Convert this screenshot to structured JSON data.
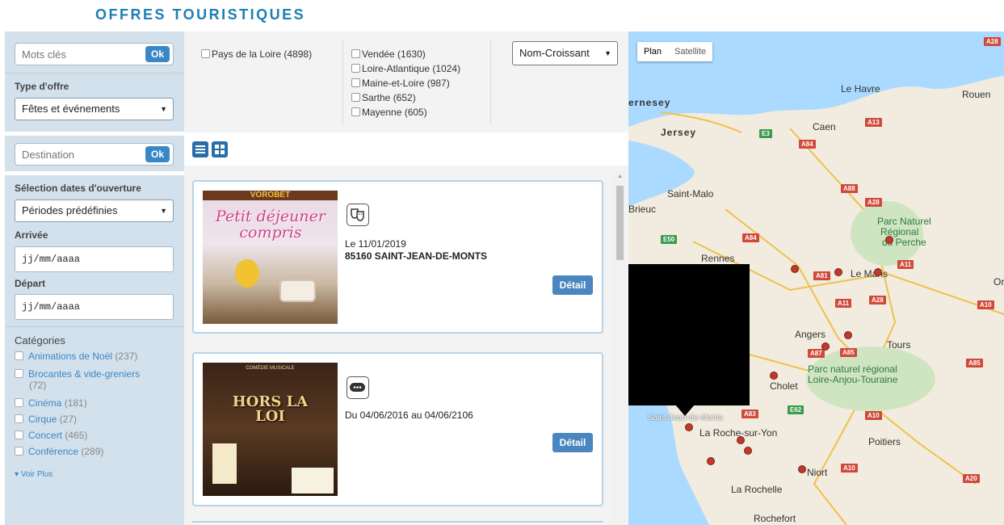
{
  "page_title": "OFFRES TOURISTIQUES",
  "sidebar": {
    "keywords_placeholder": "Mots clés",
    "ok_label": "Ok",
    "offer_type_label": "Type d'offre",
    "offer_type_value": "Fêtes et événements",
    "destination_placeholder": "Destination",
    "dates_label": "Sélection dates d'ouverture",
    "dates_value": "Périodes prédéfinies",
    "arrival_label": "Arrivée",
    "arrival_value": "jj/mm/aaaa",
    "departure_label": "Départ",
    "departure_value": "jj/mm/aaaa",
    "categories_label": "Catégories",
    "categories": [
      {
        "name": "Animations de Noël",
        "count": "(237)"
      },
      {
        "name": "Brocantes & vide-greniers",
        "count": "(72)"
      },
      {
        "name": "Cinéma",
        "count": "(181)"
      },
      {
        "name": "Cirque",
        "count": "(27)"
      },
      {
        "name": "Concert",
        "count": "(465)"
      },
      {
        "name": "Conférence",
        "count": "(289)"
      }
    ],
    "see_more": "Voir Plus"
  },
  "filters": {
    "region": "Pays de la Loire (4898)",
    "departments": [
      "Vendée (1630)",
      "Loire-Atlantique (1024)",
      "Maine-et-Loire (987)",
      "Sarthe (652)",
      "Mayenne (605)"
    ],
    "sort_value": "Nom-Croissant"
  },
  "results": [
    {
      "poster_title": "Petit déjeuner compris",
      "poster_top": "VOROBET",
      "date": "Le 11/01/2019",
      "city": "85160 SAINT-JEAN-DE-MONTS",
      "detail_label": "Détail",
      "icon": "theater-masks-icon"
    },
    {
      "poster_title": "HORS LA LOI",
      "poster_top": "COMÉDIE MUSICALE",
      "date": "Du 04/06/2016 au 04/06/2106",
      "city": "",
      "detail_label": "Détail",
      "icon": "ticket-icon"
    }
  ],
  "map": {
    "type_plan": "Plan",
    "type_satellite": "Satellite",
    "places": [
      "Le Havre",
      "Rouen",
      "ernesey",
      "Jersey",
      "Caen",
      "Saint-Malo",
      "Brieuc",
      "Rennes",
      "Le Mans",
      "Or",
      "Parc Naturel",
      "Régional",
      "du Perche",
      "Angers",
      "Tours",
      "Cholet",
      "Parc naturel régional",
      "Loire-Anjou-Touraine",
      "Saint-Jean-de-Monts",
      "La Roche-sur-Yon",
      "Poitiers",
      "Niort",
      "La Rochelle",
      "Rochefort"
    ],
    "roads": [
      "A28",
      "A13",
      "A84",
      "E3",
      "A88",
      "A28",
      "E50",
      "A84",
      "A11",
      "A81",
      "A11",
      "A28",
      "A10",
      "A87",
      "A85",
      "A85",
      "A83",
      "E62",
      "A10",
      "A10",
      "A20"
    ]
  },
  "colors": {
    "accent": "#3a87c7",
    "title": "#1e7fb3",
    "sidebar_bg": "#d3e1ec",
    "pin": "#c0392b"
  }
}
